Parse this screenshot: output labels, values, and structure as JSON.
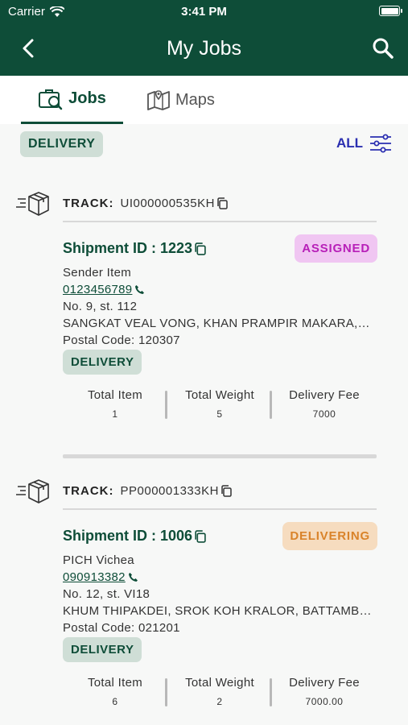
{
  "status": {
    "carrier": "Carrier",
    "time": "3:41 PM"
  },
  "nav": {
    "title": "My Jobs"
  },
  "tabs": [
    {
      "label": "Jobs",
      "active": true
    },
    {
      "label": "Maps",
      "active": false
    }
  ],
  "filter": {
    "chip": "DELIVERY",
    "all_label": "ALL"
  },
  "jobs": [
    {
      "track_label": "TRACK:",
      "track_code": "UI000000535KH",
      "shipment_id": "Shipment ID : 1223",
      "status": "ASSIGNED",
      "name": "Sender Item",
      "phone": "0123456789",
      "address1": "No. 9, st. 112",
      "address2": "SANGKAT VEAL VONG, KHAN PRAMPIR MAKARA, PHNOM PENH",
      "postal": "Postal Code: 120307",
      "type": "DELIVERY",
      "stats": [
        {
          "label": "Total Item",
          "value": "1"
        },
        {
          "label": "Total Weight",
          "value": "5"
        },
        {
          "label": "Delivery Fee",
          "value": "7000"
        }
      ]
    },
    {
      "track_label": "TRACK:",
      "track_code": "PP000001333KH",
      "shipment_id": "Shipment ID : 1006",
      "status": "DELIVERING",
      "name": "PICH Vichea",
      "phone": "090913382",
      "address1": "No. 12, st. VI18",
      "address2": "KHUM THIPAKDEI, SROK KOH KRALOR, BATTAMBANG",
      "postal": "Postal Code: 021201",
      "type": "DELIVERY",
      "stats": [
        {
          "label": "Total Item",
          "value": "6"
        },
        {
          "label": "Total Weight",
          "value": "2"
        },
        {
          "label": "Delivery Fee",
          "value": "7000.00"
        }
      ]
    }
  ],
  "colors": {
    "primary": "#0e4d38",
    "chip_bg": "#cfded6",
    "assigned_bg": "#f0c6f2",
    "assigned_fg": "#b71fb8",
    "delivering_bg": "#f6dcbf",
    "delivering_fg": "#d9832a",
    "link_blue": "#2b2fb0"
  },
  "icons": {
    "back": "chevron-left-icon",
    "search": "search-icon",
    "jobs_tab": "jobs-icon",
    "maps_tab": "map-icon",
    "filter": "filter-sliders-icon",
    "box": "delivery-box-icon",
    "copy": "copy-icon",
    "phone": "phone-icon"
  }
}
